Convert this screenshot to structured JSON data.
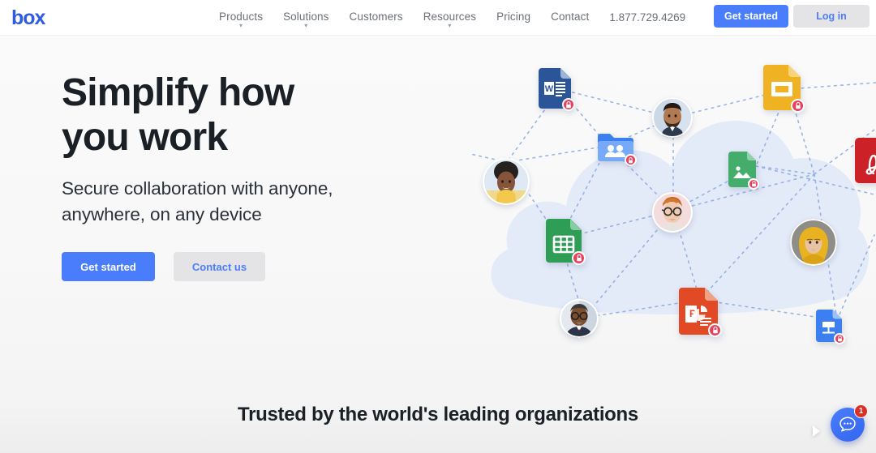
{
  "brand": {
    "logo_text": "box",
    "logo_color": "#2f5de0"
  },
  "nav": {
    "items": [
      {
        "label": "Products",
        "has_dropdown": true,
        "chevron": "chevron-down-icon"
      },
      {
        "label": "Solutions",
        "has_dropdown": true,
        "chevron": "chevron-down-icon"
      },
      {
        "label": "Customers",
        "has_dropdown": false,
        "chevron": ""
      },
      {
        "label": "Resources",
        "has_dropdown": true,
        "chevron": "chevron-down-icon"
      },
      {
        "label": "Pricing",
        "has_dropdown": false,
        "chevron": ""
      },
      {
        "label": "Contact",
        "has_dropdown": false,
        "chevron": ""
      }
    ],
    "phone": "1.877.729.4269",
    "get_started_label": "Get started",
    "login_label": "Log in",
    "primary_color": "#4a7dfc",
    "secondary_bg": "#e4e4e6"
  },
  "hero": {
    "headline_line1": "Simplify how",
    "headline_line2": "you work",
    "subhead_line1": "Secure collaboration with anyone,",
    "subhead_line2": "anywhere, on any device",
    "cta_primary_label": "Get started",
    "cta_secondary_label": "Contact us"
  },
  "illustration": {
    "cloud_color": "#e3eaf8",
    "line_color": "#8aa9e0",
    "lock_badge_color": "#e8405a",
    "nodes": [
      {
        "name": "word-document-icon",
        "type": "file",
        "file_kind": "word",
        "color": "#2a5699",
        "locked": true
      },
      {
        "name": "shared-folder-icon",
        "type": "file",
        "file_kind": "folder",
        "color": "#5b9bf8",
        "locked": true
      },
      {
        "name": "google-slides-icon",
        "type": "file",
        "file_kind": "slides",
        "color": "#efb223",
        "locked": true
      },
      {
        "name": "image-file-icon",
        "type": "file",
        "file_kind": "image",
        "color": "#45ad6b",
        "locked": true
      },
      {
        "name": "pdf-document-icon",
        "type": "file",
        "file_kind": "pdf",
        "color": "#cc2127",
        "locked": false
      },
      {
        "name": "google-sheets-icon",
        "type": "file",
        "file_kind": "sheets",
        "color": "#2e9e57",
        "locked": true
      },
      {
        "name": "powerpoint-document-icon",
        "type": "file",
        "file_kind": "powerpoint",
        "color": "#e24a26",
        "locked": true
      },
      {
        "name": "google-drawings-icon",
        "type": "file",
        "file_kind": "drawings",
        "color": "#3b7ff0",
        "locked": true
      },
      {
        "name": "avatar-woman-curly",
        "type": "avatar",
        "tone": "#caa徽"
      },
      {
        "name": "avatar-man-beard",
        "type": "avatar"
      },
      {
        "name": "avatar-man-glasses",
        "type": "avatar"
      },
      {
        "name": "avatar-woman-scarf",
        "type": "avatar"
      },
      {
        "name": "avatar-man-suit",
        "type": "avatar"
      }
    ]
  },
  "trusted": {
    "title": "Trusted by the world's leading organizations"
  },
  "chat": {
    "badge_count": "1",
    "icon": "chat-bubble-icon",
    "accent": "#3366ef",
    "badge_color": "#d93025"
  }
}
